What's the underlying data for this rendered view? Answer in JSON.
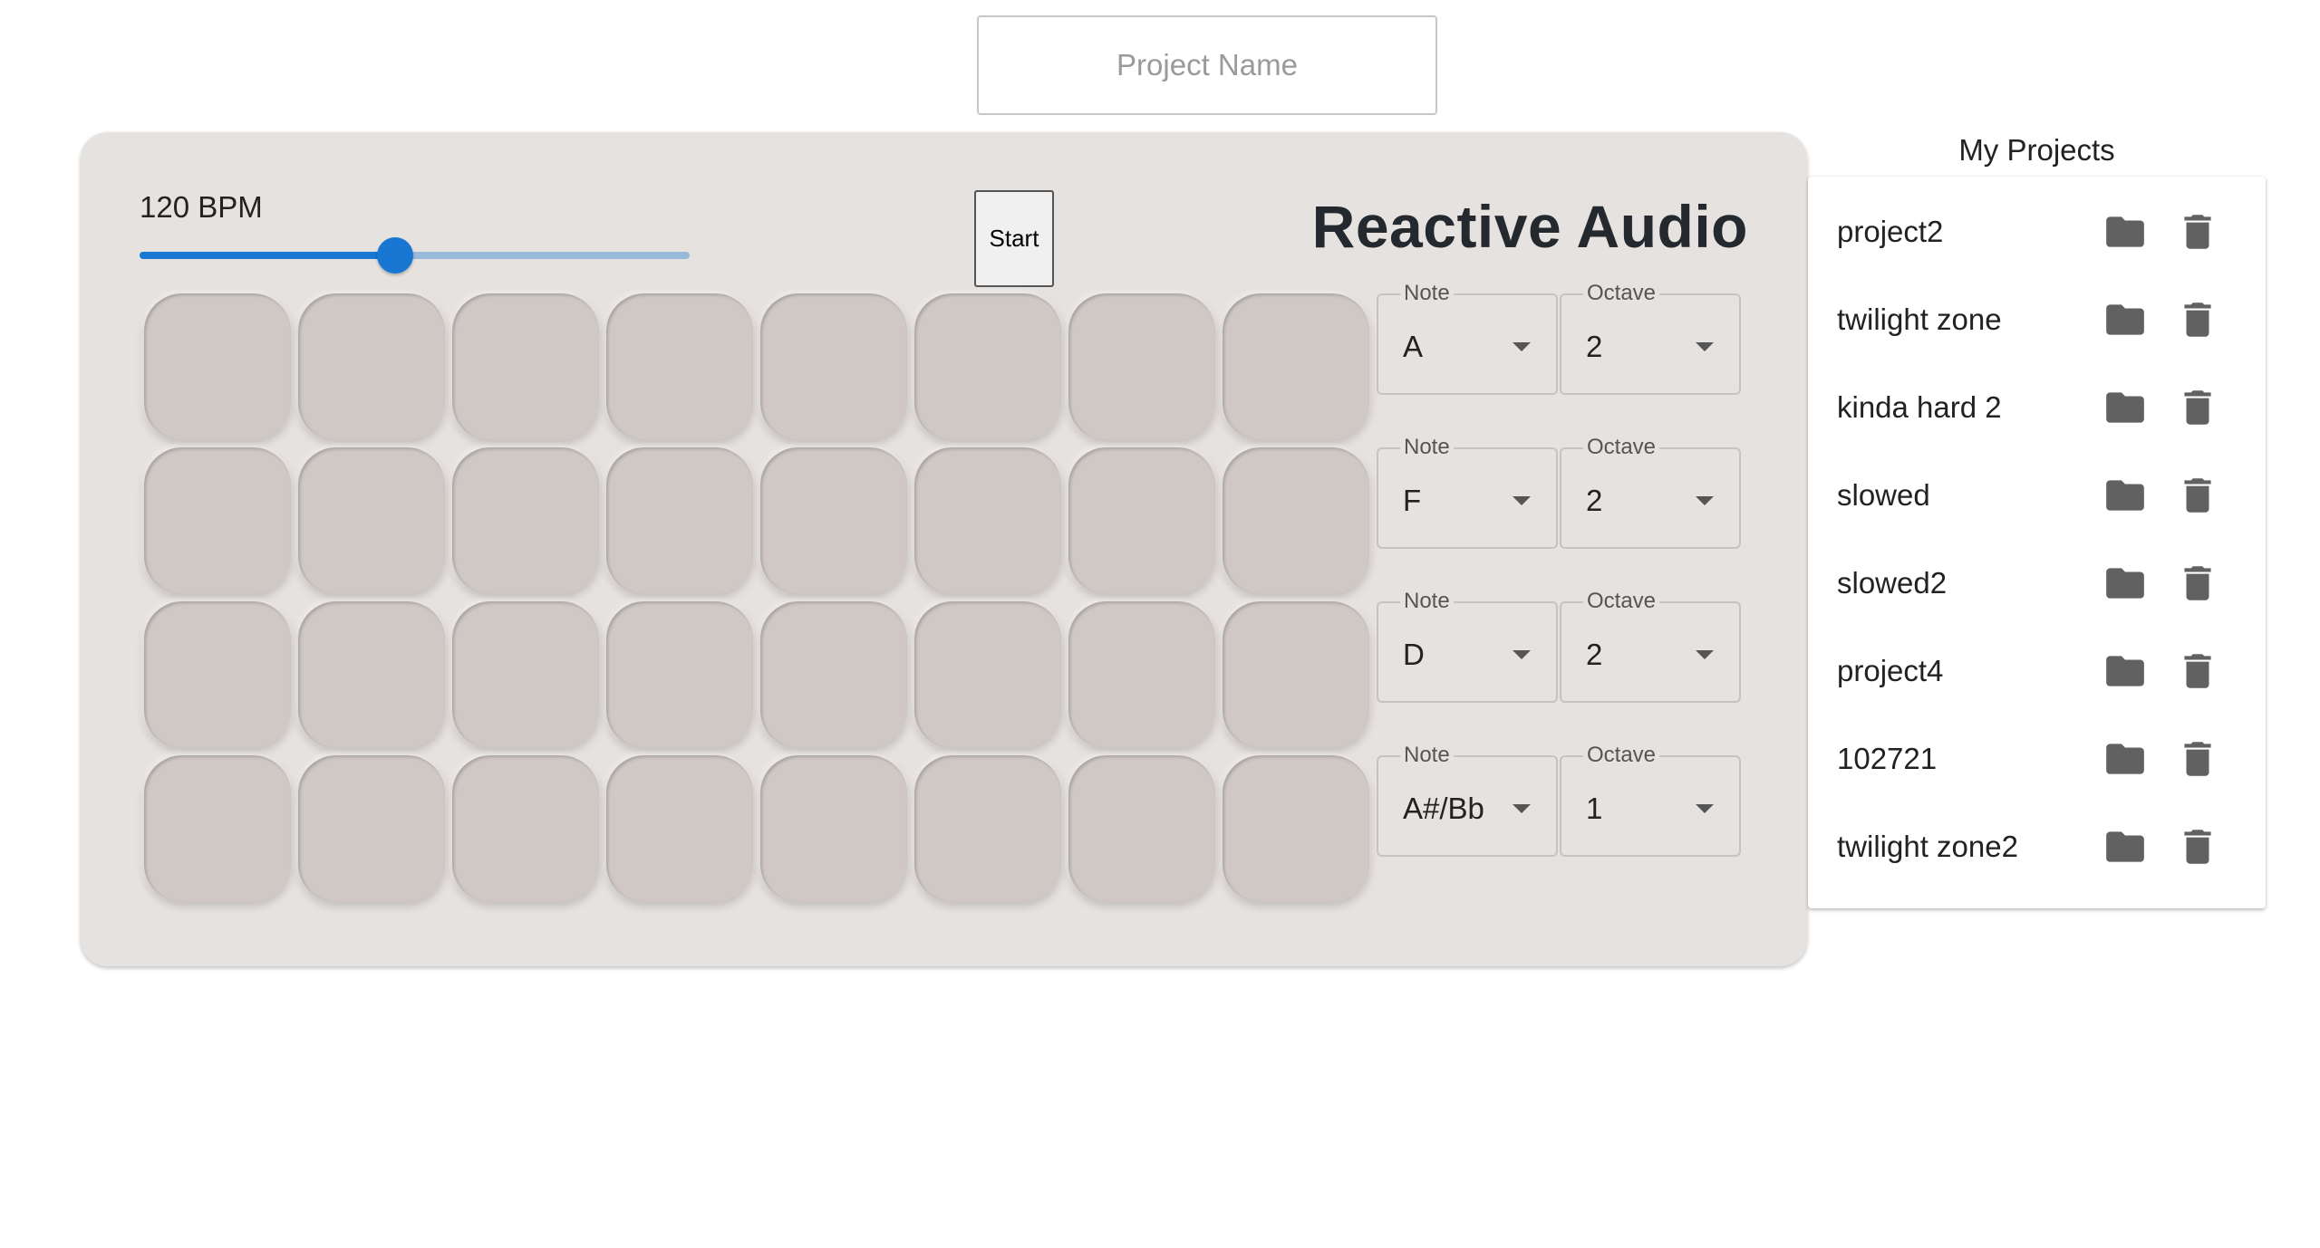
{
  "header": {
    "project_name_placeholder": "Project Name"
  },
  "sequencer": {
    "title": "Reactive Audio",
    "bpm_label": "120 BPM",
    "bpm_value": 120,
    "bpm_slider_fraction": 0.465,
    "start_label": "Start",
    "rows": [
      {
        "note_legend": "Note",
        "note": "A",
        "octave_legend": "Octave",
        "octave": "2"
      },
      {
        "note_legend": "Note",
        "note": "F",
        "octave_legend": "Octave",
        "octave": "2"
      },
      {
        "note_legend": "Note",
        "note": "D",
        "octave_legend": "Octave",
        "octave": "2"
      },
      {
        "note_legend": "Note",
        "note": "A#/Bb",
        "octave_legend": "Octave",
        "octave": "1"
      }
    ],
    "steps_per_row": 8
  },
  "projects": {
    "title": "My Projects",
    "items": [
      {
        "label": "project2"
      },
      {
        "label": "twilight zone"
      },
      {
        "label": "kinda hard 2"
      },
      {
        "label": "slowed"
      },
      {
        "label": "slowed2"
      },
      {
        "label": "project4"
      },
      {
        "label": "102721"
      },
      {
        "label": "twilight zone2"
      }
    ],
    "folder_icon": "folder-icon",
    "delete_icon": "trash-icon"
  },
  "colors": {
    "accent": "#1976d2",
    "panel_bg": "#e6e2df",
    "pad": "#cfc8c4",
    "icon": "#616161"
  }
}
